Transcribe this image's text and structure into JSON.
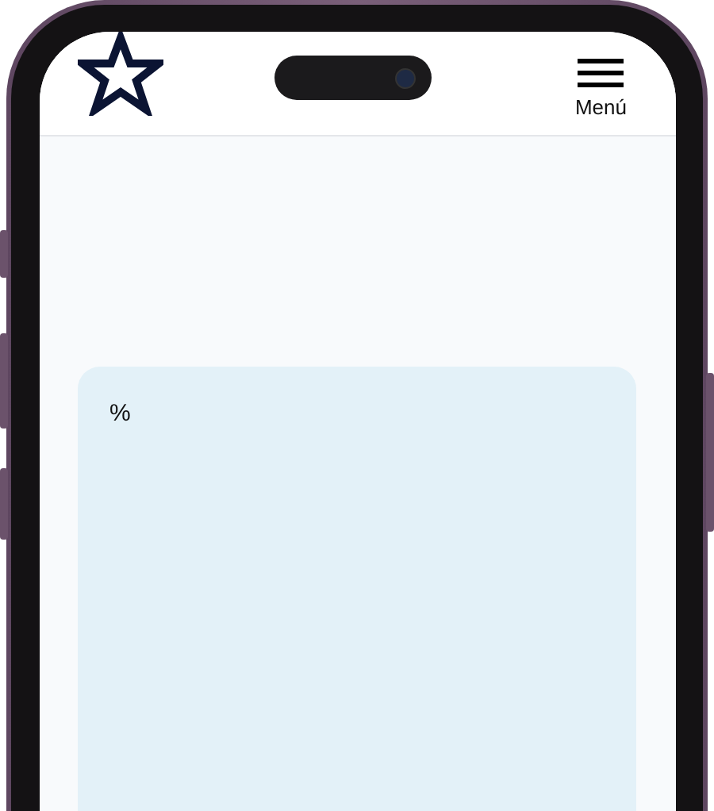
{
  "header": {
    "menu_label": "Menú"
  },
  "card": {
    "label": "%"
  }
}
